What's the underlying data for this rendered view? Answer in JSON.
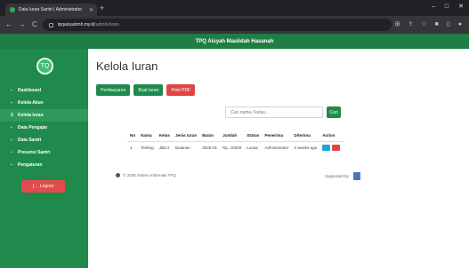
{
  "browser": {
    "tab_title": "Data Iuran Santri | Administrator",
    "url_host": "tpqaisyahmh.my.id",
    "url_path": "/admin/iuran",
    "new_tab": "+",
    "nav": {
      "back": "←",
      "forward": "→",
      "reload": "C"
    },
    "window": {
      "minimize": "–",
      "maximize": "□",
      "close": "✕"
    }
  },
  "app": {
    "title": "TPQ Aisyah Maulidah Hasanah"
  },
  "sidebar": {
    "logo_glyph": "TQ",
    "items": [
      {
        "label": "Dashboard",
        "icon": "▪",
        "active": false
      },
      {
        "label": "Kelola Akun",
        "icon": "▪",
        "active": false
      },
      {
        "label": "Kelola Iuran",
        "icon": "$",
        "active": true
      },
      {
        "label": "Data Pengajar",
        "icon": "▪",
        "active": false
      },
      {
        "label": "Data Santri",
        "icon": "▪",
        "active": false
      },
      {
        "label": "Presensi Santri",
        "icon": "▪",
        "active": false
      },
      {
        "label": "Pengaturan",
        "icon": "▪",
        "active": false
      }
    ],
    "logout_label": "[→ Logout"
  },
  "main": {
    "title": "Kelola Iuran",
    "buttons": {
      "pembayaran": "Pembayaran",
      "buat_iuran": "Buat Iuran",
      "print_pdf": "Print PDF"
    },
    "search": {
      "placeholder": "Cari nama / kelas...",
      "button": "Cari"
    },
    "table": {
      "headers": [
        "No",
        "Nama",
        "Kelas",
        "Jenis Iuran",
        "Bulan",
        "Jumlah",
        "Status",
        "Penerima",
        "Diterima",
        "Action"
      ],
      "rows": [
        [
          "1",
          "Testing",
          "Jilid 2",
          "Bulanan",
          "2025-01",
          "Rp. 10000",
          "Lunas",
          "Administrator",
          "2 weeks ago"
        ]
      ]
    },
    "footer": "© 2025 Sistem Informasi TPQ",
    "supported_by": "Supported by :"
  },
  "colors": {
    "primary": "#1f8a4c",
    "danger": "#e04545",
    "info": "#1aa7e0"
  }
}
